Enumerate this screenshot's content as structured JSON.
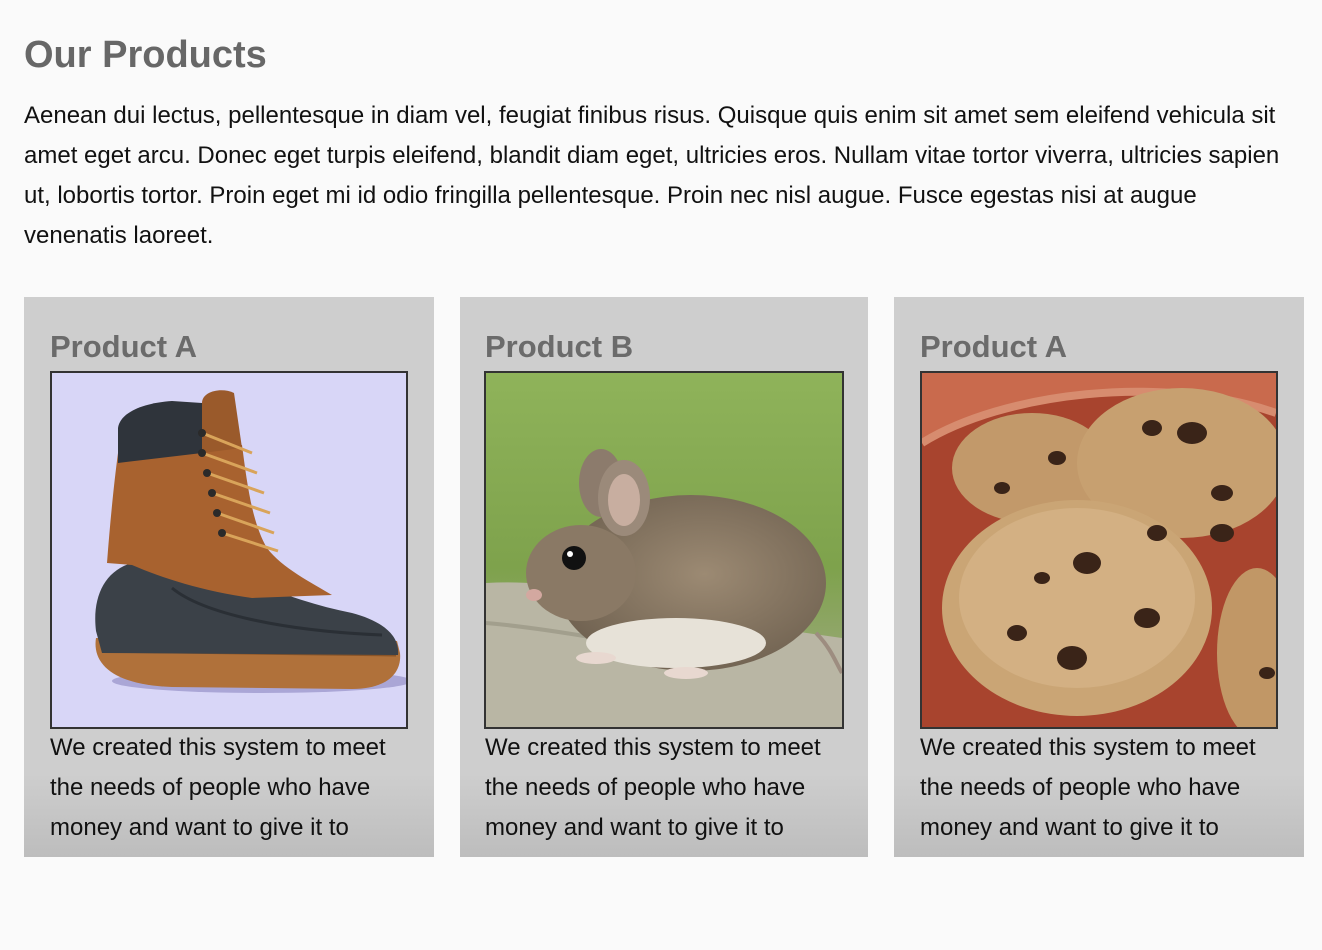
{
  "page": {
    "title": "Our Products",
    "intro": "Aenean dui lectus, pellentesque in diam vel, feugiat finibus risus. Quisque quis enim sit amet sem eleifend vehicula sit amet eget arcu. Donec eget turpis eleifend, blandit diam eget, ultricies eros. Nullam vitae tortor viverra, ultricies sapien ut, lobortis tortor. Proin eget mi id odio fringilla pellentesque. Proin nec nisl augue. Fusce egestas nisi at augue venenatis laoreet."
  },
  "products": [
    {
      "name": "Product A",
      "image": "boot-image",
      "description": "We created this system to meet the needs of people who have money and want to give it to"
    },
    {
      "name": "Product B",
      "image": "mouse-image",
      "description": "We created this system to meet the needs of people who have money and want to give it to"
    },
    {
      "name": "Product A",
      "image": "cookies-image",
      "description": "We created this system to meet the needs of people who have money and want to give it to"
    }
  ],
  "colors": {
    "page_background": "#fafafa",
    "title": "#676767",
    "card_background": "#cecece",
    "card_title": "#6b6b6b",
    "image_border": "#333333"
  }
}
